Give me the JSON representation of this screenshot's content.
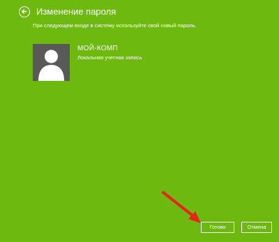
{
  "header": {
    "title": "Изменение пароля"
  },
  "main": {
    "instruction": "При следующем входе в систему используйте свой новый пароль.",
    "account": {
      "name": "МОЙ-КОМП",
      "type": "Локальная учетная запись"
    }
  },
  "footer": {
    "done_label": "Готово",
    "cancel_label": "Отмена"
  },
  "colors": {
    "background": "#6db90f",
    "avatar_bg": "#595959",
    "annotation_arrow": "#e8231a"
  },
  "icons": {
    "back": "back-arrow-icon",
    "avatar": "user-silhouette-icon"
  }
}
